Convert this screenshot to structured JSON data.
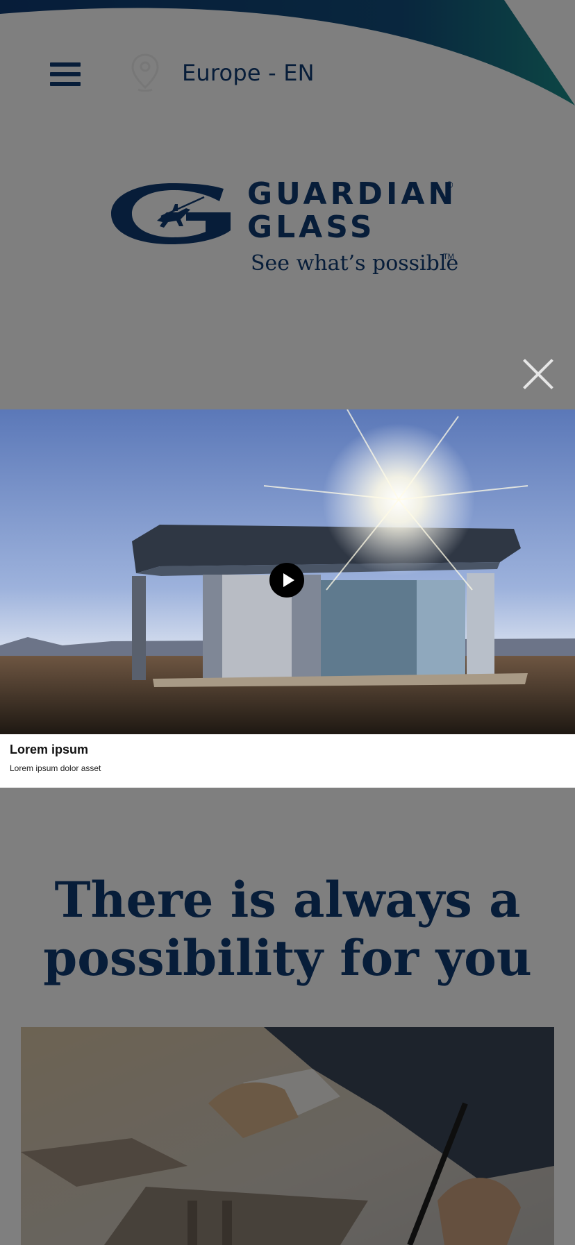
{
  "header": {
    "menu_icon": "hamburger-menu-icon",
    "location_icon": "location-pin-icon",
    "region": "Europe - EN"
  },
  "brand": {
    "line1": "GUARDIAN",
    "line2": "GLASS",
    "tagline": "See what’s possible",
    "registered_mark": "®",
    "trademark": "TM",
    "colors": {
      "primary": "#0e3a73",
      "accent_teal": "#188a86"
    }
  },
  "modal": {
    "close_icon": "close-icon",
    "play_icon": "play-icon",
    "caption_title": "Lorem ipsum",
    "caption_subtitle": "Lorem ipsum dolor asset"
  },
  "hero": {
    "headline_line1": "There is always a",
    "headline_line2": "possibility for you"
  }
}
